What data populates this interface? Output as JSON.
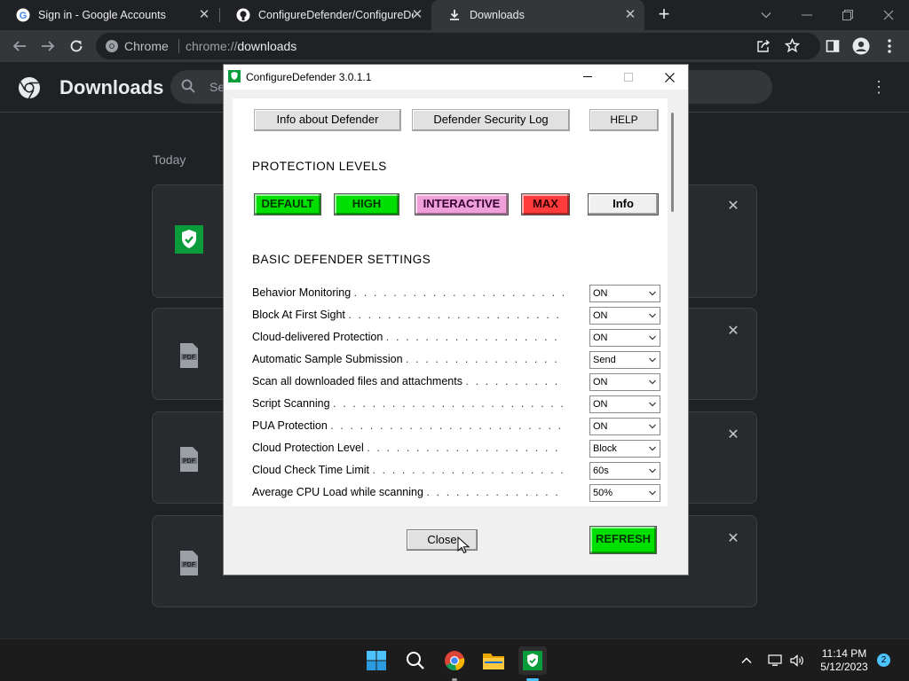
{
  "browser": {
    "tabs": [
      {
        "label": "Sign in - Google Accounts",
        "icon": "google-g-icon"
      },
      {
        "label": "ConfigureDefender/ConfigureDe",
        "icon": "github-icon"
      },
      {
        "label": "Downloads",
        "icon": "download-icon"
      }
    ],
    "omnibox": {
      "site_label": "Chrome",
      "url_scheme": "chrome://",
      "url_path": "downloads"
    }
  },
  "downloads_page": {
    "title": "Downloads",
    "search_placeholder": "Se",
    "date_header": "Today"
  },
  "dialog": {
    "title": "ConfigureDefender 3.0.1.1",
    "top_buttons": {
      "info": "Info about Defender",
      "log": "Defender Security Log",
      "help": "HELP"
    },
    "protection_header": "PROTECTION LEVELS",
    "levels": {
      "default": "DEFAULT",
      "high": "HIGH",
      "interactive": "INTERACTIVE",
      "max": "MAX",
      "info": "Info"
    },
    "basic_header": "BASIC DEFENDER SETTINGS",
    "settings": [
      {
        "label": "Behavior Monitoring",
        "dots": ". . . . . . . . . . . . . . . . . . . . . . . . . . . . .",
        "value": "ON"
      },
      {
        "label": "Block At First Sight",
        "dots": ". . . . . . . . . . . . . . . . . . . . . . . . . . . . .",
        "value": "ON"
      },
      {
        "label": "Cloud-delivered Protection",
        "dots": ". . . . . . . . . . . . . . . . . . . . . . . .",
        "value": "ON"
      },
      {
        "label": "Automatic Sample Submission",
        "dots": ". . . . . . . . . . . . . . . . . . . . . .",
        "value": "Send"
      },
      {
        "label": "Scan all downloaded files and attachments",
        "dots": ". . . . . . . . . . . .",
        "value": "ON"
      },
      {
        "label": "Script Scanning",
        "dots": ". . . . . . . . . . . . . . . . . . . . . . . . . . . . . . . .",
        "value": "ON"
      },
      {
        "label": "PUA Protection",
        "dots": ". . . . . . . . . . . . . . . . . . . . . . . . . . . . . . . . .",
        "value": "ON"
      },
      {
        "label": "Cloud Protection Level",
        "dots": ". . . . . . . . . . . . . . . . . . . . . . . . . . . .",
        "value": "Block"
      },
      {
        "label": "Cloud Check Time Limit",
        "dots": ". . . . . . . . . . . . . . . . . . . . . . . . . . .",
        "value": "60s"
      },
      {
        "label": "Average CPU Load while scanning",
        "dots": ". . . . . . . . . . . . . . . . . . . .",
        "value": "50%"
      }
    ],
    "close_label": "Close",
    "refresh_label": "REFRESH"
  },
  "taskbar": {
    "time": "11:14 PM",
    "date": "5/12/2023",
    "notification_count": "2"
  },
  "colors": {
    "level_green": "#00e000",
    "level_pink": "#f0a0d8",
    "level_red": "#ff3b3b",
    "defender_green": "#0a9b3a"
  }
}
